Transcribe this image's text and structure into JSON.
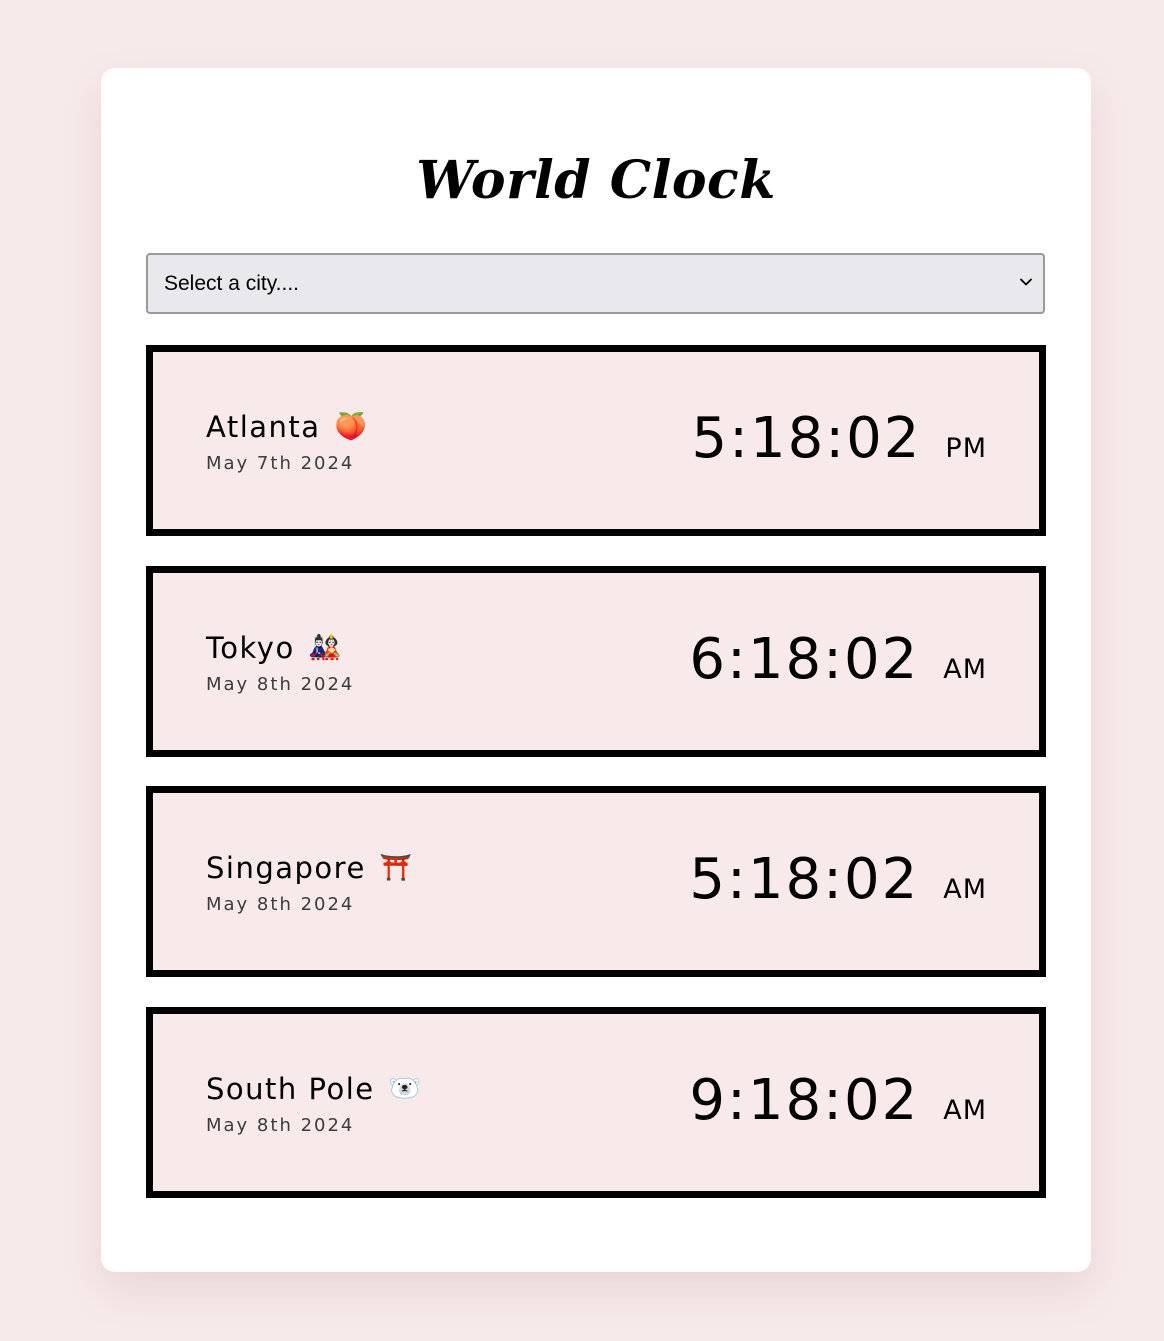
{
  "app": {
    "title": "World Clock"
  },
  "city_select": {
    "selected": "Select a city...."
  },
  "cities": [
    {
      "name": "Atlanta",
      "emoji": "🍑",
      "date": "May 7th 2024",
      "time": "5:18:02",
      "ampm": "PM"
    },
    {
      "name": "Tokyo",
      "emoji": "🎎",
      "date": "May 8th 2024",
      "time": "6:18:02",
      "ampm": "AM"
    },
    {
      "name": "Singapore",
      "emoji": "⛩️",
      "date": "May 8th 2024",
      "time": "5:18:02",
      "ampm": "AM"
    },
    {
      "name": "South Pole",
      "emoji": "🐻‍❄️",
      "date": "May 8th 2024",
      "time": "9:18:02",
      "ampm": "AM"
    }
  ]
}
